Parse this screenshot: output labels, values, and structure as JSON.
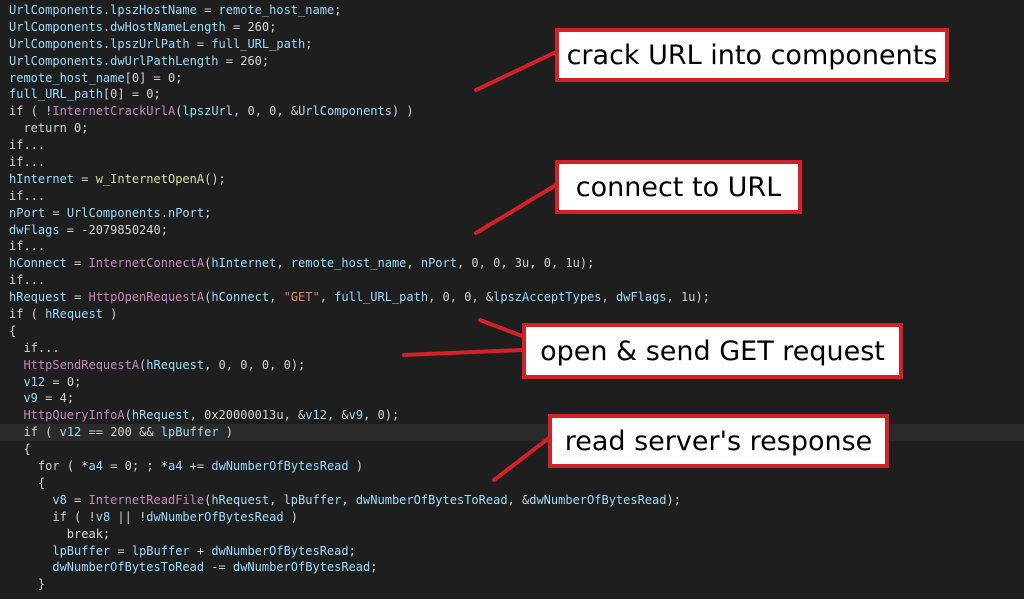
{
  "code_lines": [
    {
      "indent": "",
      "tokens": [
        [
          "id",
          "UrlComponents"
        ],
        [
          "op",
          "."
        ],
        [
          "id",
          "lpszHostName"
        ],
        [
          "op",
          " = "
        ],
        [
          "id",
          "remote_host_name"
        ],
        [
          "op",
          ";"
        ]
      ]
    },
    {
      "indent": "",
      "tokens": [
        [
          "id",
          "UrlComponents"
        ],
        [
          "op",
          "."
        ],
        [
          "id",
          "dwHostNameLength"
        ],
        [
          "op",
          " = "
        ],
        [
          "num",
          "260"
        ],
        [
          "op",
          ";"
        ]
      ]
    },
    {
      "indent": "",
      "tokens": [
        [
          "id",
          "UrlComponents"
        ],
        [
          "op",
          "."
        ],
        [
          "id",
          "lpszUrlPath"
        ],
        [
          "op",
          " = "
        ],
        [
          "id",
          "full_URL_path"
        ],
        [
          "op",
          ";"
        ]
      ]
    },
    {
      "indent": "",
      "tokens": [
        [
          "id",
          "UrlComponents"
        ],
        [
          "op",
          "."
        ],
        [
          "id",
          "dwUrlPathLength"
        ],
        [
          "op",
          " = "
        ],
        [
          "num",
          "260"
        ],
        [
          "op",
          ";"
        ]
      ]
    },
    {
      "indent": "",
      "tokens": [
        [
          "id",
          "remote_host_name"
        ],
        [
          "op",
          "["
        ],
        [
          "num",
          "0"
        ],
        [
          "op",
          "] = "
        ],
        [
          "num",
          "0"
        ],
        [
          "op",
          ";"
        ]
      ]
    },
    {
      "indent": "",
      "tokens": [
        [
          "id",
          "full_URL_path"
        ],
        [
          "op",
          "["
        ],
        [
          "num",
          "0"
        ],
        [
          "op",
          "] = "
        ],
        [
          "num",
          "0"
        ],
        [
          "op",
          ";"
        ]
      ]
    },
    {
      "indent": "",
      "tokens": [
        [
          "kw",
          "if"
        ],
        [
          "op",
          " ( !"
        ],
        [
          "fn",
          "InternetCrackUrlA"
        ],
        [
          "op",
          "("
        ],
        [
          "id",
          "lpszUrl"
        ],
        [
          "op",
          ", "
        ],
        [
          "num",
          "0"
        ],
        [
          "op",
          ", "
        ],
        [
          "num",
          "0"
        ],
        [
          "op",
          ", &"
        ],
        [
          "id",
          "UrlComponents"
        ],
        [
          "op",
          ") )"
        ]
      ]
    },
    {
      "indent": "  ",
      "tokens": [
        [
          "kw",
          "return"
        ],
        [
          "op",
          " "
        ],
        [
          "num",
          "0"
        ],
        [
          "op",
          ";"
        ]
      ]
    },
    {
      "indent": "",
      "tokens": [
        [
          "kw",
          "if..."
        ]
      ]
    },
    {
      "indent": "",
      "tokens": [
        [
          "kw",
          "if..."
        ]
      ]
    },
    {
      "indent": "",
      "tokens": [
        [
          "id",
          "hInternet"
        ],
        [
          "op",
          " = "
        ],
        [
          "w",
          "w_InternetOpenA"
        ],
        [
          "op",
          "();"
        ]
      ]
    },
    {
      "indent": "",
      "tokens": [
        [
          "kw",
          "if..."
        ]
      ]
    },
    {
      "indent": "",
      "tokens": [
        [
          "id",
          "nPort"
        ],
        [
          "op",
          " = "
        ],
        [
          "id",
          "UrlComponents"
        ],
        [
          "op",
          "."
        ],
        [
          "id",
          "nPort"
        ],
        [
          "op",
          ";"
        ]
      ]
    },
    {
      "indent": "",
      "tokens": [
        [
          "id",
          "dwFlags"
        ],
        [
          "op",
          " = -"
        ],
        [
          "num",
          "2079850240"
        ],
        [
          "op",
          ";"
        ]
      ]
    },
    {
      "indent": "",
      "tokens": [
        [
          "kw",
          "if..."
        ]
      ]
    },
    {
      "indent": "",
      "tokens": [
        [
          "id",
          "hConnect"
        ],
        [
          "op",
          " = "
        ],
        [
          "fn",
          "InternetConnectA"
        ],
        [
          "op",
          "("
        ],
        [
          "id",
          "hInternet"
        ],
        [
          "op",
          ", "
        ],
        [
          "id",
          "remote_host_name"
        ],
        [
          "op",
          ", "
        ],
        [
          "id",
          "nPort"
        ],
        [
          "op",
          ", "
        ],
        [
          "num",
          "0"
        ],
        [
          "op",
          ", "
        ],
        [
          "num",
          "0"
        ],
        [
          "op",
          ", "
        ],
        [
          "num",
          "3u"
        ],
        [
          "op",
          ", "
        ],
        [
          "num",
          "0"
        ],
        [
          "op",
          ", "
        ],
        [
          "num",
          "1u"
        ],
        [
          "op",
          ");"
        ]
      ]
    },
    {
      "indent": "",
      "tokens": [
        [
          "kw",
          "if..."
        ]
      ]
    },
    {
      "indent": "",
      "tokens": [
        [
          "id",
          "hRequest"
        ],
        [
          "op",
          " = "
        ],
        [
          "fn",
          "HttpOpenRequestA"
        ],
        [
          "op",
          "("
        ],
        [
          "id",
          "hConnect"
        ],
        [
          "op",
          ", "
        ],
        [
          "str",
          "\"GET\""
        ],
        [
          "op",
          ", "
        ],
        [
          "id",
          "full_URL_path"
        ],
        [
          "op",
          ", "
        ],
        [
          "num",
          "0"
        ],
        [
          "op",
          ", "
        ],
        [
          "num",
          "0"
        ],
        [
          "op",
          ", &"
        ],
        [
          "id",
          "lpszAcceptTypes"
        ],
        [
          "op",
          ", "
        ],
        [
          "id",
          "dwFlags"
        ],
        [
          "op",
          ", "
        ],
        [
          "num",
          "1u"
        ],
        [
          "op",
          ");"
        ]
      ]
    },
    {
      "indent": "",
      "tokens": [
        [
          "kw",
          "if"
        ],
        [
          "op",
          " ( "
        ],
        [
          "id",
          "hRequest"
        ],
        [
          "op",
          " )"
        ]
      ]
    },
    {
      "indent": "",
      "tokens": [
        [
          "op",
          "{"
        ]
      ]
    },
    {
      "indent": "  ",
      "tokens": [
        [
          "kw",
          "if..."
        ]
      ]
    },
    {
      "indent": "  ",
      "tokens": [
        [
          "fn",
          "HttpSendRequestA"
        ],
        [
          "op",
          "("
        ],
        [
          "id",
          "hRequest"
        ],
        [
          "op",
          ", "
        ],
        [
          "num",
          "0"
        ],
        [
          "op",
          ", "
        ],
        [
          "num",
          "0"
        ],
        [
          "op",
          ", "
        ],
        [
          "num",
          "0"
        ],
        [
          "op",
          ", "
        ],
        [
          "num",
          "0"
        ],
        [
          "op",
          ");"
        ]
      ]
    },
    {
      "indent": "  ",
      "tokens": [
        [
          "id",
          "v12"
        ],
        [
          "op",
          " = "
        ],
        [
          "num",
          "0"
        ],
        [
          "op",
          ";"
        ]
      ]
    },
    {
      "indent": "  ",
      "tokens": [
        [
          "id",
          "v9"
        ],
        [
          "op",
          " = "
        ],
        [
          "num",
          "4"
        ],
        [
          "op",
          ";"
        ]
      ]
    },
    {
      "indent": "  ",
      "tokens": [
        [
          "fn",
          "HttpQueryInfoA"
        ],
        [
          "op",
          "("
        ],
        [
          "id",
          "hRequest"
        ],
        [
          "op",
          ", "
        ],
        [
          "num",
          "0x20000013u"
        ],
        [
          "op",
          ", &"
        ],
        [
          "id",
          "v12"
        ],
        [
          "op",
          ", &"
        ],
        [
          "id",
          "v9"
        ],
        [
          "op",
          ", "
        ],
        [
          "num",
          "0"
        ],
        [
          "op",
          ");"
        ]
      ]
    },
    {
      "indent": "  ",
      "tokens": [
        [
          "kw",
          "if"
        ],
        [
          "op",
          " ( "
        ],
        [
          "id",
          "v12"
        ],
        [
          "op",
          " == "
        ],
        [
          "num",
          "200"
        ],
        [
          "op",
          " && "
        ],
        [
          "id",
          "lpBuffer"
        ],
        [
          "op",
          " )"
        ]
      ],
      "highlight": true
    },
    {
      "indent": "  ",
      "tokens": [
        [
          "op",
          "{"
        ]
      ]
    },
    {
      "indent": "    ",
      "tokens": [
        [
          "kw",
          "for"
        ],
        [
          "op",
          " ( *"
        ],
        [
          "id",
          "a4"
        ],
        [
          "op",
          " = "
        ],
        [
          "num",
          "0"
        ],
        [
          "op",
          "; ; *"
        ],
        [
          "id",
          "a4"
        ],
        [
          "op",
          " += "
        ],
        [
          "id",
          "dwNumberOfBytesRead"
        ],
        [
          "op",
          " )"
        ]
      ]
    },
    {
      "indent": "    ",
      "tokens": [
        [
          "op",
          "{"
        ]
      ]
    },
    {
      "indent": "      ",
      "tokens": [
        [
          "id",
          "v8"
        ],
        [
          "op",
          " = "
        ],
        [
          "fn",
          "InternetReadFile"
        ],
        [
          "op",
          "("
        ],
        [
          "id",
          "hRequest"
        ],
        [
          "op",
          ", "
        ],
        [
          "id",
          "lpBuffer"
        ],
        [
          "op",
          ", "
        ],
        [
          "id",
          "dwNumberOfBytesToRead"
        ],
        [
          "op",
          ", &"
        ],
        [
          "id",
          "dwNumberOfBytesRead"
        ],
        [
          "op",
          ");"
        ]
      ]
    },
    {
      "indent": "      ",
      "tokens": [
        [
          "kw",
          "if"
        ],
        [
          "op",
          " ( !"
        ],
        [
          "id",
          "v8"
        ],
        [
          "op",
          " || !"
        ],
        [
          "id",
          "dwNumberOfBytesRead"
        ],
        [
          "op",
          " )"
        ]
      ]
    },
    {
      "indent": "        ",
      "tokens": [
        [
          "kw",
          "break"
        ],
        [
          "op",
          ";"
        ]
      ]
    },
    {
      "indent": "      ",
      "tokens": [
        [
          "id",
          "lpBuffer"
        ],
        [
          "op",
          " = "
        ],
        [
          "id",
          "lpBuffer"
        ],
        [
          "op",
          " + "
        ],
        [
          "id",
          "dwNumberOfBytesRead"
        ],
        [
          "op",
          ";"
        ]
      ]
    },
    {
      "indent": "      ",
      "tokens": [
        [
          "id",
          "dwNumberOfBytesToRead"
        ],
        [
          "op",
          " -= "
        ],
        [
          "id",
          "dwNumberOfBytesRead"
        ],
        [
          "op",
          ";"
        ]
      ]
    },
    {
      "indent": "    ",
      "tokens": [
        [
          "op",
          "}"
        ]
      ]
    }
  ],
  "callouts": [
    {
      "label": "crack URL into components"
    },
    {
      "label": "connect to URL"
    },
    {
      "label": "open & send GET request"
    },
    {
      "label": "read server's response"
    }
  ],
  "colors": {
    "background": "#1e1e1e",
    "identifier": "#9cdcfe",
    "api_function": "#c586c0",
    "string": "#ce9178",
    "callout_border": "#d42027",
    "arrow": "#d42027"
  }
}
